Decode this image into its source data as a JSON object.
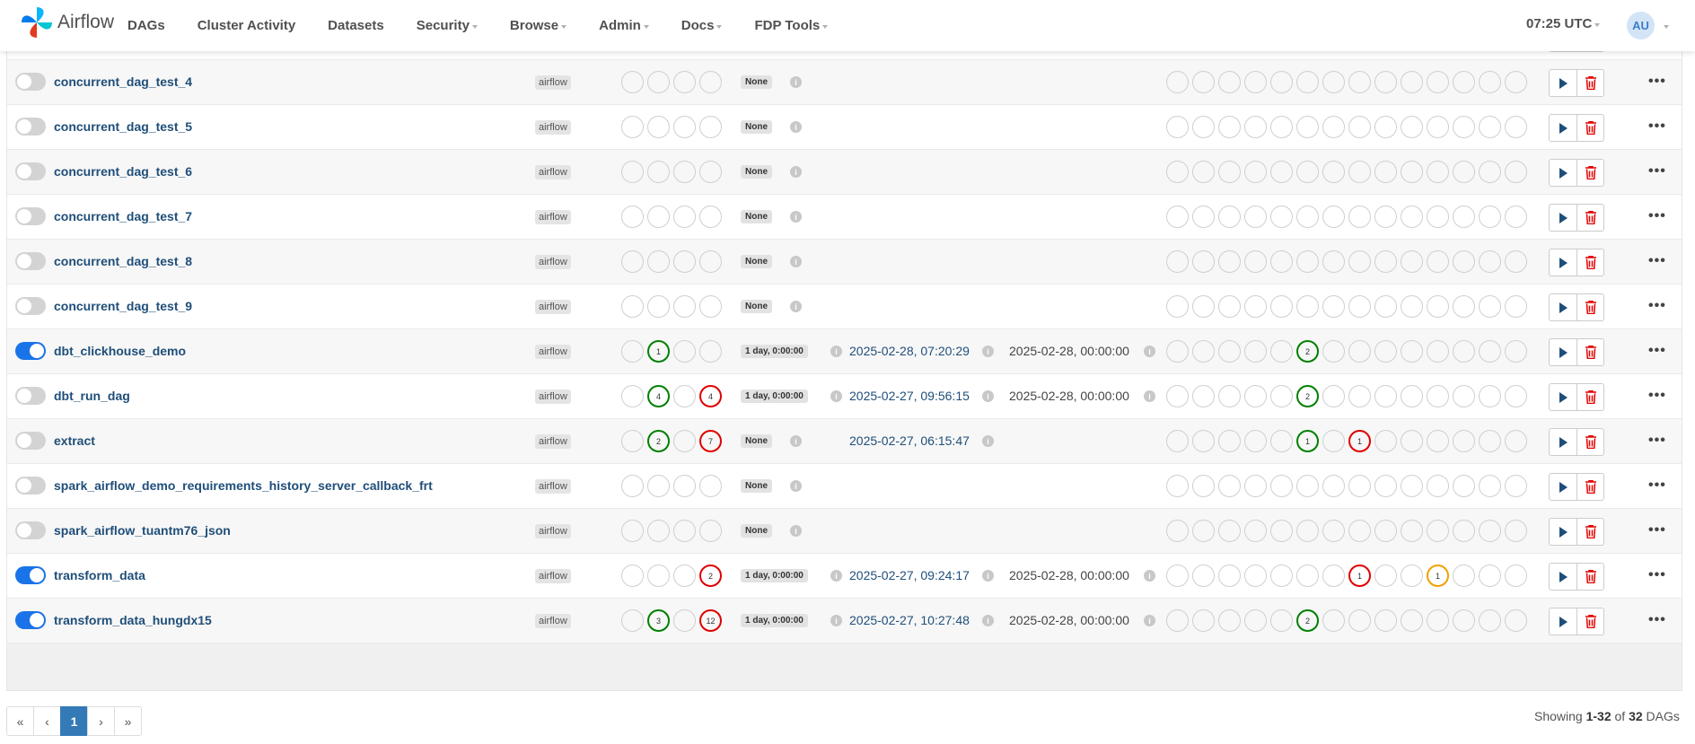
{
  "brand": {
    "name": "Airflow"
  },
  "nav": {
    "items": [
      {
        "label": "DAGs",
        "dropdown": false
      },
      {
        "label": "Cluster Activity",
        "dropdown": false
      },
      {
        "label": "Datasets",
        "dropdown": false
      },
      {
        "label": "Security",
        "dropdown": true
      },
      {
        "label": "Browse",
        "dropdown": true
      },
      {
        "label": "Admin",
        "dropdown": true
      },
      {
        "label": "Docs",
        "dropdown": true
      },
      {
        "label": "FDP Tools",
        "dropdown": true
      }
    ],
    "time": "07:25 UTC",
    "user_initials": "AU"
  },
  "colors": {
    "success": "#008000",
    "failed": "#e00000",
    "queued": "#f0a000",
    "toggle_on": "#1a73e8",
    "link": "#1f4e79"
  },
  "rows": [
    {
      "name": "concurrent_dag_test_4",
      "paused": true,
      "owner": "airflow",
      "runs": [
        "",
        "",
        "",
        ""
      ],
      "schedule": "None",
      "last_run": "",
      "next_run": "",
      "recent": []
    },
    {
      "name": "concurrent_dag_test_5",
      "paused": true,
      "owner": "airflow",
      "runs": [
        "",
        "",
        "",
        ""
      ],
      "schedule": "None",
      "last_run": "",
      "next_run": "",
      "recent": []
    },
    {
      "name": "concurrent_dag_test_6",
      "paused": true,
      "owner": "airflow",
      "runs": [
        "",
        "",
        "",
        ""
      ],
      "schedule": "None",
      "last_run": "",
      "next_run": "",
      "recent": []
    },
    {
      "name": "concurrent_dag_test_7",
      "paused": true,
      "owner": "airflow",
      "runs": [
        "",
        "",
        "",
        ""
      ],
      "schedule": "None",
      "last_run": "",
      "next_run": "",
      "recent": []
    },
    {
      "name": "concurrent_dag_test_8",
      "paused": true,
      "owner": "airflow",
      "runs": [
        "",
        "",
        "",
        ""
      ],
      "schedule": "None",
      "last_run": "",
      "next_run": "",
      "recent": []
    },
    {
      "name": "concurrent_dag_test_9",
      "paused": true,
      "owner": "airflow",
      "runs": [
        "",
        "",
        "",
        ""
      ],
      "schedule": "None",
      "last_run": "",
      "next_run": "",
      "recent": []
    },
    {
      "name": "dbt_clickhouse_demo",
      "paused": false,
      "owner": "airflow",
      "runs": [
        "",
        "g:1",
        "",
        ""
      ],
      "schedule": "1 day, 0:00:00",
      "last_run": "2025-02-28, 07:20:29",
      "next_run": "2025-02-28, 00:00:00",
      "recent": [
        {
          "i": 5,
          "c": "g",
          "n": "2"
        }
      ]
    },
    {
      "name": "dbt_run_dag",
      "paused": true,
      "owner": "airflow",
      "runs": [
        "",
        "g:4",
        "",
        "r:4"
      ],
      "schedule": "1 day, 0:00:00",
      "last_run": "2025-02-27, 09:56:15",
      "next_run": "2025-02-28, 00:00:00",
      "recent": [
        {
          "i": 5,
          "c": "g",
          "n": "2"
        }
      ]
    },
    {
      "name": "extract",
      "paused": true,
      "owner": "airflow",
      "runs": [
        "",
        "g:2",
        "",
        "r:7"
      ],
      "schedule": "None",
      "last_run": "2025-02-27, 06:15:47",
      "next_run": "",
      "recent": [
        {
          "i": 5,
          "c": "g",
          "n": "1"
        },
        {
          "i": 7,
          "c": "r",
          "n": "1"
        }
      ]
    },
    {
      "name": "spark_airflow_demo_requirements_history_server_callback_frt",
      "paused": true,
      "owner": "airflow",
      "runs": [
        "",
        "",
        "",
        ""
      ],
      "schedule": "None",
      "last_run": "",
      "next_run": "",
      "recent": []
    },
    {
      "name": "spark_airflow_tuantm76_json",
      "paused": true,
      "owner": "airflow",
      "runs": [
        "",
        "",
        "",
        ""
      ],
      "schedule": "None",
      "last_run": "",
      "next_run": "",
      "recent": []
    },
    {
      "name": "transform_data",
      "paused": false,
      "owner": "airflow",
      "runs": [
        "",
        "",
        "",
        "r:2"
      ],
      "schedule": "1 day, 0:00:00",
      "last_run": "2025-02-27, 09:24:17",
      "next_run": "2025-02-28, 00:00:00",
      "recent": [
        {
          "i": 7,
          "c": "r",
          "n": "1"
        },
        {
          "i": 10,
          "c": "o",
          "n": "1"
        }
      ]
    },
    {
      "name": "transform_data_hungdx15",
      "paused": false,
      "owner": "airflow",
      "runs": [
        "",
        "g:3",
        "",
        "r:12"
      ],
      "schedule": "1 day, 0:00:00",
      "last_run": "2025-02-27, 10:27:48",
      "next_run": "2025-02-28, 00:00:00",
      "recent": [
        {
          "i": 5,
          "c": "g",
          "n": "2"
        }
      ]
    }
  ],
  "pagination": {
    "pages": [
      "«",
      "‹",
      "1",
      "›",
      "»"
    ],
    "active": "1"
  },
  "footer": {
    "prefix": "Showing ",
    "range": "1-32",
    "middle": " of ",
    "total": "32",
    "suffix": " DAGs"
  }
}
